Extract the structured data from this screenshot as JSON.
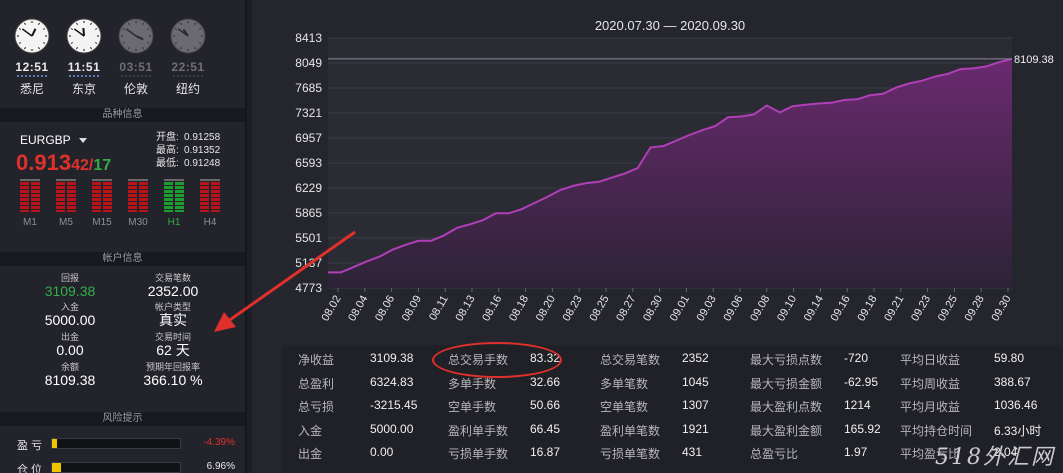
{
  "clocks": [
    {
      "time": "12:51",
      "city": "悉尼",
      "active": true,
      "h": 0.85,
      "m": 51
    },
    {
      "time": "11:51",
      "city": "东京",
      "active": true,
      "h": 11.85,
      "m": 51
    },
    {
      "time": "03:51",
      "city": "伦敦",
      "active": false,
      "h": 3.85,
      "m": 51
    },
    {
      "time": "22:51",
      "city": "纽约",
      "active": false,
      "h": 10.85,
      "m": 51
    }
  ],
  "sections": {
    "pair_info": "品种信息",
    "account_info": "帐户信息",
    "risk": "风险提示"
  },
  "symbol": {
    "name": "EURGBP",
    "price_big": "0.913",
    "price_mid": "42",
    "slash": "/",
    "price_green": "17",
    "open_label": "开盘:",
    "open": "0.91258",
    "high_label": "最高:",
    "high": "0.91352",
    "low_label": "最低:",
    "low": "0.91248"
  },
  "timeframes": [
    {
      "label": "M1",
      "green": false
    },
    {
      "label": "M5",
      "green": false
    },
    {
      "label": "M15",
      "green": false
    },
    {
      "label": "M30",
      "green": false
    },
    {
      "label": "H1",
      "green": true
    },
    {
      "label": "H4",
      "green": false
    }
  ],
  "account": {
    "return_label": "回报",
    "return": "3109.38",
    "trades_label": "交易笔数",
    "trades": "2352.00",
    "deposit_label": "入金",
    "deposit": "5000.00",
    "type_label": "帐户类型",
    "type": "真实",
    "withdraw_label": "出金",
    "withdraw": "0.00",
    "time_label": "交易时间",
    "time": "62 天",
    "balance_label": "余额",
    "balance": "8109.38",
    "annual_label": "预期年回报率",
    "annual": "366.10 %"
  },
  "risk": {
    "profit_label": "盈 亏",
    "profit_pct": "-4.39%",
    "profit_fill": 0.04,
    "position_label": "仓 位",
    "position_pct": "6.96%",
    "position_fill": 0.07
  },
  "chart_data": {
    "type": "area",
    "title": "2020.07.30 — 2020.09.30",
    "last_value_label": "8109.38",
    "y_ticks": [
      8413,
      8049,
      7685,
      7321,
      6957,
      6593,
      6229,
      5865,
      5501,
      5137,
      4773
    ],
    "ylim": [
      4773,
      8413
    ],
    "x_ticks": [
      "08.02",
      "08.04",
      "08.06",
      "08.09",
      "08.11",
      "08.13",
      "08.16",
      "08.18",
      "08.20",
      "08.23",
      "08.25",
      "08.27",
      "08.30",
      "09.01",
      "09.03",
      "09.06",
      "09.08",
      "09.10",
      "09.14",
      "09.16",
      "09.18",
      "09.21",
      "09.23",
      "09.25",
      "09.28",
      "09.30"
    ],
    "values": [
      5000,
      5000,
      5080,
      5160,
      5230,
      5330,
      5400,
      5460,
      5460,
      5540,
      5650,
      5700,
      5760,
      5860,
      5860,
      5920,
      6010,
      6100,
      6200,
      6260,
      6300,
      6320,
      6380,
      6440,
      6520,
      6820,
      6840,
      6920,
      7000,
      7070,
      7130,
      7260,
      7270,
      7300,
      7430,
      7330,
      7420,
      7440,
      7460,
      7470,
      7510,
      7520,
      7580,
      7600,
      7690,
      7750,
      7790,
      7850,
      7890,
      7960,
      7970,
      8000,
      8060,
      8109.38
    ],
    "colors": {
      "line": "#b03fb8",
      "fill_top": "#6a2a6f",
      "fill_bottom": "#2d2337"
    }
  },
  "stats": [
    [
      [
        "净收益",
        "3109.38"
      ],
      [
        "总盈利",
        "6324.83"
      ],
      [
        "总亏损",
        "-3215.45"
      ],
      [
        "入金",
        "5000.00"
      ],
      [
        "出金",
        "0.00"
      ]
    ],
    [
      [
        "总交易手数",
        "83.32"
      ],
      [
        "多单手数",
        "32.66"
      ],
      [
        "空单手数",
        "50.66"
      ],
      [
        "盈利单手数",
        "66.45"
      ],
      [
        "亏损单手数",
        "16.87"
      ]
    ],
    [
      [
        "总交易笔数",
        "2352"
      ],
      [
        "多单笔数",
        "1045"
      ],
      [
        "空单笔数",
        "1307"
      ],
      [
        "盈利单笔数",
        "1921"
      ],
      [
        "亏损单笔数",
        "431"
      ]
    ],
    [
      [
        "最大亏损点数",
        "-720"
      ],
      [
        "最大亏损金额",
        "-62.95"
      ],
      [
        "最大盈利点数",
        "1214"
      ],
      [
        "最大盈利金额",
        "165.92"
      ],
      [
        "总盈亏比",
        "1.97"
      ]
    ],
    [
      [
        "平均日收益",
        "59.80"
      ],
      [
        "平均周收益",
        "388.67"
      ],
      [
        "平均月收益",
        "1036.46"
      ],
      [
        "平均持仓时间",
        "6.33小时"
      ],
      [
        "平均盈亏比",
        "2.04"
      ]
    ]
  ],
  "watermark": "518外汇网"
}
